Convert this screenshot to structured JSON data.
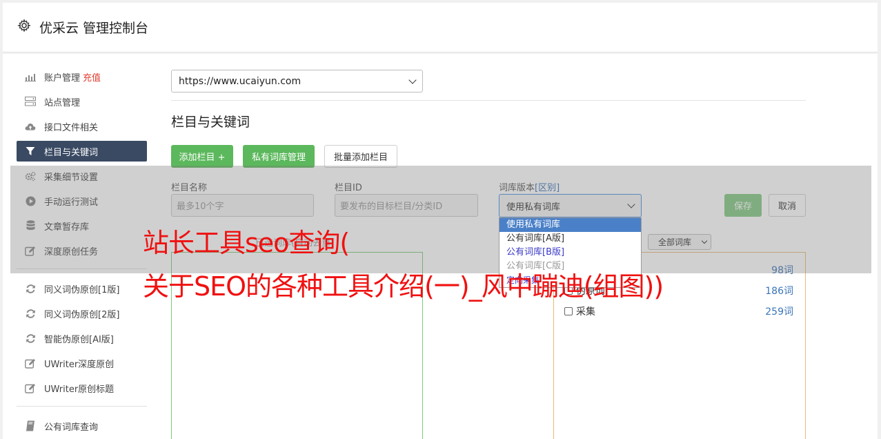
{
  "header": {
    "title": "优采云 管理控制台"
  },
  "sidebar": {
    "items": [
      {
        "label": "账户管理",
        "badge": "充值",
        "icon": "bar-chart-icon"
      },
      {
        "label": "站点管理",
        "icon": "server-icon"
      },
      {
        "label": "接口文件相关",
        "icon": "cloud-upload-icon"
      },
      {
        "label": "栏目与关键词",
        "icon": "filter-icon",
        "active": true
      },
      {
        "label": "采集细节设置",
        "icon": "cogs-icon"
      },
      {
        "label": "手动运行测试",
        "icon": "play-circle-icon"
      },
      {
        "label": "文章暂存库",
        "icon": "database-icon"
      },
      {
        "label": "深度原创任务",
        "icon": "edit-icon"
      }
    ],
    "items2": [
      {
        "label": "同义词伪原创[1版]",
        "icon": "refresh-icon"
      },
      {
        "label": "同义词伪原创[2版]",
        "icon": "refresh-icon"
      },
      {
        "label": "智能伪原创[AI版]",
        "icon": "refresh-icon"
      },
      {
        "label": "UWriter深度原创",
        "icon": "edit-icon"
      },
      {
        "label": "UWriter原创标题",
        "icon": "edit-icon"
      }
    ],
    "items3": [
      {
        "label": "公有词库查询",
        "icon": "book-icon"
      }
    ]
  },
  "main": {
    "site_select": "https://www.ucaiyun.com",
    "section_title": "栏目与关键词",
    "buttons": {
      "add_column": "添加栏目 +",
      "private_lib": "私有词库管理",
      "batch_add": "批量添加栏目"
    },
    "form": {
      "name_label": "栏目名称",
      "name_placeholder": "最多10个字",
      "id_label": "栏目ID",
      "id_placeholder": "要发布的目标栏目/分类ID",
      "lib_label": "词库版本",
      "lib_label_link": "[区别]",
      "lib_value": "使用私有词库",
      "save": "保存",
      "cancel": "取消"
    },
    "dropdown_options": [
      "使用私有词库",
      "公有词库[A版]",
      "公有词库[B版]",
      "公有词库[C版]",
      "定向采集"
    ],
    "left_box_hint": "已选词库(自动去重)",
    "filter_select": "全部词库",
    "libraries": [
      {
        "name": "",
        "count": "98词"
      },
      {
        "name": "伪原创",
        "count": "186词"
      },
      {
        "name": "采集",
        "count": "259词"
      }
    ]
  },
  "overlay_text": {
    "line1": "站长工具seo查询(",
    "line2": "关于SEO的各种工具介绍(一)_风中蹦迪(组图))"
  }
}
